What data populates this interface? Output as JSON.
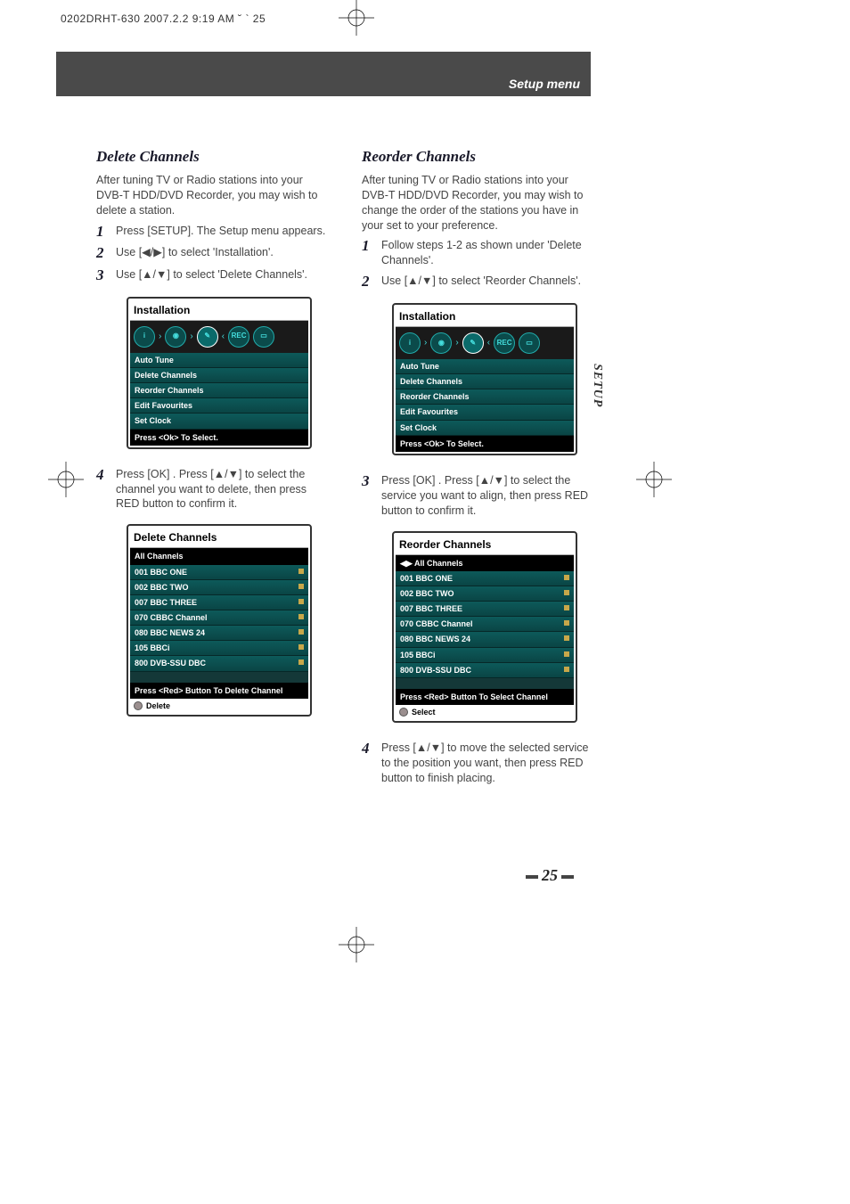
{
  "header_line": "0202DRHT-630  2007.2.2 9:19 AM  ˘   `   25",
  "band_label": "Setup menu",
  "side_tab": "SETUP",
  "page_number": "25",
  "left": {
    "title": "Delete  Channels",
    "intro": "After tuning TV or Radio stations into your DVB-T HDD/DVD Recorder, you may wish to delete a station.",
    "steps": [
      {
        "n": "1",
        "t": "Press [SETUP]. The Setup menu appears."
      },
      {
        "n": "2",
        "t": "Use [◀/▶] to select 'Installation'."
      },
      {
        "n": "3",
        "t": "Use [▲/▼] to select 'Delete Channels'."
      }
    ],
    "osd1": {
      "title": "Installation",
      "items": [
        "Auto Tune",
        "Delete Channels",
        "Reorder Channels",
        "Edit Favourites",
        "Set Clock"
      ],
      "foot": "Press <Ok> To Select."
    },
    "step4": {
      "n": "4",
      "t": "Press [OK] . Press [▲/▼] to select the channel you want to delete, then press RED button to confirm it."
    },
    "osd2": {
      "title": "Delete Channels",
      "band": "All Channels",
      "rows": [
        "001 BBC ONE",
        "002 BBC TWO",
        "007 BBC THREE",
        "070 CBBC Channel",
        "080 BBC NEWS 24",
        "105 BBCi",
        "800 DVB-SSU DBC"
      ],
      "foot": "Press <Red> Button To Delete Channel",
      "sub": "Delete"
    }
  },
  "right": {
    "title": "Reorder Channels",
    "intro": "After tuning TV or Radio stations into your DVB-T HDD/DVD Recorder, you may wish to change the order of the stations you have in your set to your preference.",
    "steps": [
      {
        "n": "1",
        "t": "Follow steps 1-2 as shown under 'Delete Channels'."
      },
      {
        "n": "2",
        "t": "Use [▲/▼] to select 'Reorder Channels'."
      }
    ],
    "osd1": {
      "title": "Installation",
      "items": [
        "Auto Tune",
        "Delete Channels",
        "Reorder Channels",
        "Edit Favourites",
        "Set Clock"
      ],
      "foot": "Press <Ok> To Select."
    },
    "step3": {
      "n": "3",
      "t": "Press [OK] . Press [▲/▼] to select the service you want to align, then press RED button to confirm it."
    },
    "osd2": {
      "title": "Reorder Channels",
      "band": "◀▶ All Channels",
      "rows": [
        "001 BBC ONE",
        "002 BBC TWO",
        "007 BBC THREE",
        "070 CBBC Channel",
        "080 BBC NEWS 24",
        "105 BBCi",
        "800 DVB-SSU DBC"
      ],
      "foot": "Press <Red> Button To Select Channel",
      "sub": "Select"
    },
    "step4": {
      "n": "4",
      "t": "Press [▲/▼] to move the selected service to the position you want, then press RED button to finish placing."
    }
  },
  "icons": {
    "rec": "REC",
    "i": "i"
  }
}
